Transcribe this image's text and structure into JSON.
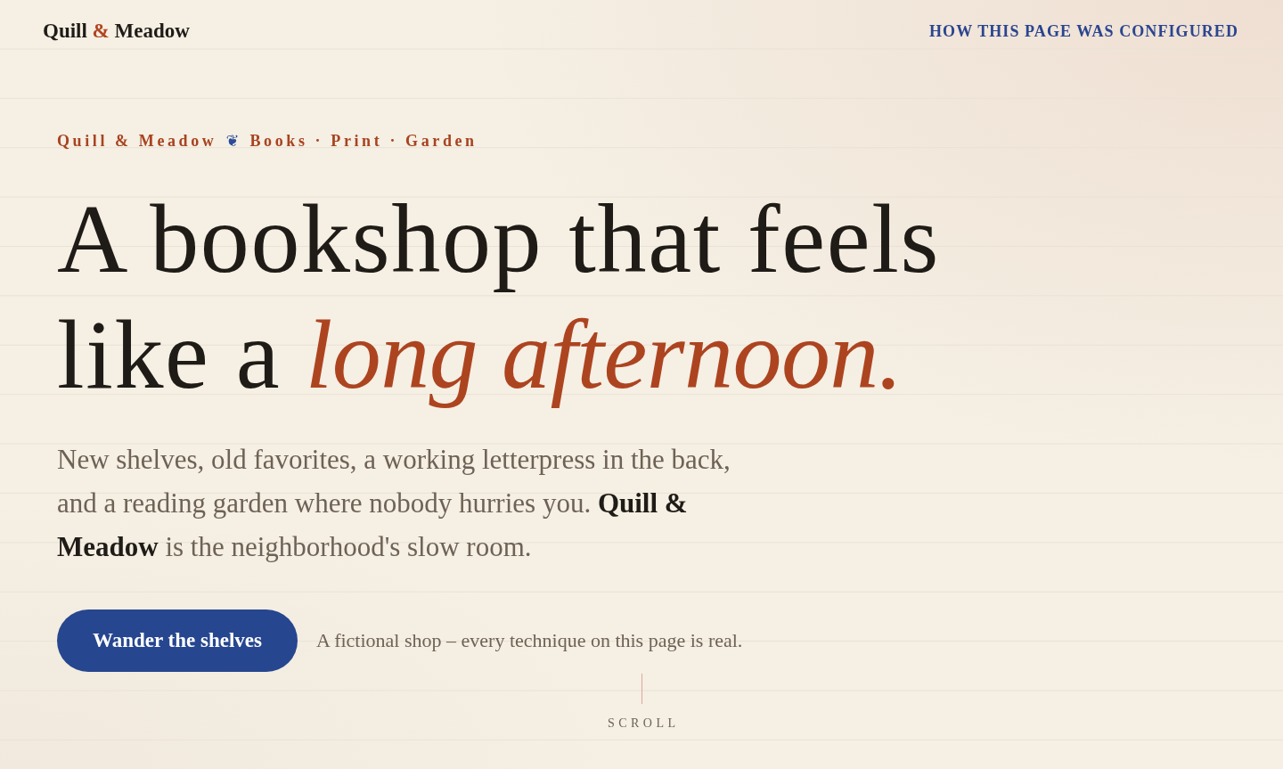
{
  "header": {
    "brand": [
      {
        "text": "Quill",
        "accent": false
      },
      {
        "text": "&",
        "accent": true
      },
      {
        "text": "Meadow",
        "accent": false
      }
    ],
    "link": "HOW THIS PAGE WAS CONFIGURED"
  },
  "hero": {
    "eyebrow": [
      {
        "text": "Quill & Meadow",
        "kind": "label"
      },
      {
        "text": "❦",
        "kind": "ornament"
      },
      {
        "text": "Books · Print · Garden",
        "kind": "label"
      }
    ],
    "headline": [
      [
        {
          "text": "A bookshop that feels",
          "accent": false
        }
      ],
      [
        {
          "text": "like a",
          "accent": false
        },
        {
          "text": "long afternoon.",
          "accent": true
        }
      ]
    ],
    "intro": "New shelves, old favorites, a working letterpress in the back, and a reading garden where nobody hurries you. **Quill & Meadow** is the neighborhood's slow room.",
    "button": "Wander the shelves",
    "note": "A fictional shop – every technique on this page is real."
  },
  "scroll_cue": "SCROLL"
}
